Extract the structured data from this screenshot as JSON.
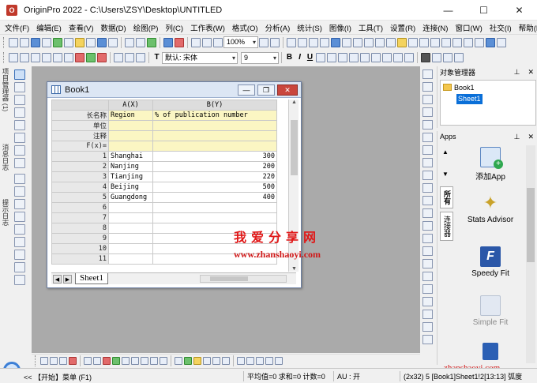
{
  "window": {
    "title": "OriginPro 2022 - C:\\Users\\ZSY\\Desktop\\UNTITLED",
    "controls": [
      "—",
      "☐",
      "✕"
    ]
  },
  "menu": [
    "文件(F)",
    "编辑(E)",
    "查看(V)",
    "数据(D)",
    "绘图(P)",
    "列(C)",
    "工作表(W)",
    "格式(O)",
    "分析(A)",
    "统计(S)",
    "图像(I)",
    "工具(T)",
    "设置(R)",
    "连接(N)",
    "窗口(W)",
    "社交(I)",
    "帮助(H)"
  ],
  "toolbar": {
    "zoom": "100%",
    "font": "默认: 宋体",
    "font_size": "9",
    "bold": "B",
    "italic": "I",
    "underline": "U",
    "text_tool": "T"
  },
  "left_labels": {
    "project_explorer": "项目管理器 (1)",
    "message_log": "消息日志",
    "hint_log": "提示日志"
  },
  "book": {
    "title": "Book1",
    "col_a": "A(X)",
    "col_b": "B(Y)",
    "meta_rows": [
      {
        "label": "长名称",
        "a": "Region",
        "b": "% of publication number"
      },
      {
        "label": "单位",
        "a": "",
        "b": ""
      },
      {
        "label": "注释",
        "a": "",
        "b": ""
      },
      {
        "label": "F(x)=",
        "a": "",
        "b": ""
      }
    ],
    "rows": [
      {
        "n": "1",
        "a": "Shanghai",
        "b": "300"
      },
      {
        "n": "2",
        "a": "Nanjing",
        "b": "200"
      },
      {
        "n": "3",
        "a": "Tianjing",
        "b": "220"
      },
      {
        "n": "4",
        "a": "Beijing",
        "b": "500"
      },
      {
        "n": "5",
        "a": "Guangdong",
        "b": "400"
      },
      {
        "n": "6",
        "a": "",
        "b": ""
      },
      {
        "n": "7",
        "a": "",
        "b": ""
      },
      {
        "n": "8",
        "a": "",
        "b": ""
      },
      {
        "n": "9",
        "a": "",
        "b": ""
      },
      {
        "n": "10",
        "a": "",
        "b": ""
      },
      {
        "n": "11",
        "a": "",
        "b": ""
      }
    ],
    "sheet_tab": "Sheet1"
  },
  "watermark": {
    "cn": "我爱分享网",
    "url": "www.zhanshaoyi.com",
    "url_bottom": "zhanshaoyi.com"
  },
  "object_manager": {
    "title": "对象管理器",
    "book": "Book1",
    "sheet": "Sheet1"
  },
  "apps": {
    "title": "Apps",
    "tabs": [
      "所有",
      "连接器"
    ],
    "items": [
      {
        "label": "添加App",
        "enabled": true
      },
      {
        "label": "Stats Advisor",
        "enabled": true
      },
      {
        "label": "Speedy Fit",
        "enabled": true
      },
      {
        "label": "Simple Fit",
        "enabled": false
      }
    ]
  },
  "status": {
    "start": "<< 【开始】菜单 (F1)",
    "stats": "平均值=0 求和=0 计数=0",
    "au": "AU : 开",
    "info": "(2x32) 5 [Book1]Sheet1!2[13:13] 弧度"
  },
  "colors": {
    "workspace": "#aaaaaa",
    "meta_fill": "#fbf6c3",
    "selection": "#0a6fd8",
    "close_button": "#c9463d",
    "watermark": "#e01818"
  }
}
